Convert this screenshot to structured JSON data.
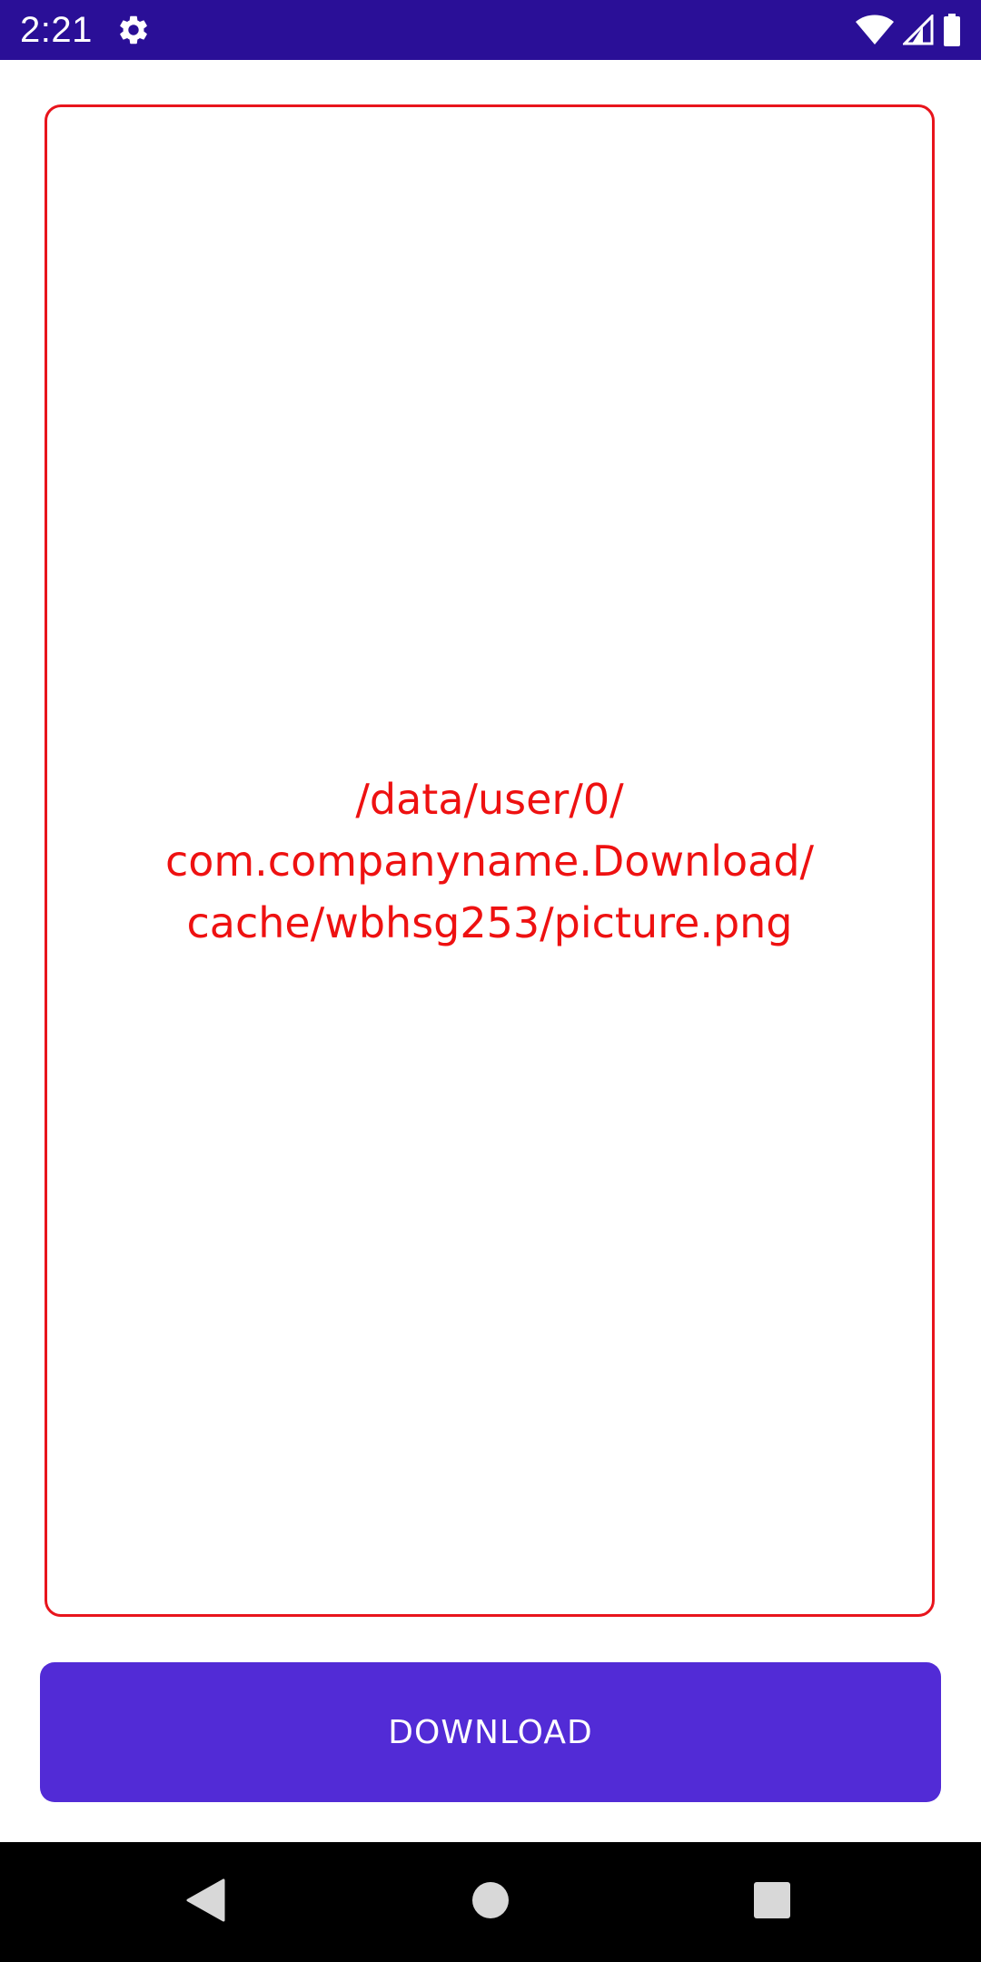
{
  "status_bar": {
    "time": "2:21",
    "background": "#2a0f97",
    "icons": [
      "settings-icon",
      "wifi-icon",
      "cellular-signal-icon",
      "battery-icon"
    ]
  },
  "main": {
    "path_lines": [
      "/data/user/0/",
      "com.companyname.Download/",
      "cache/wbhsg253/picture.png"
    ],
    "path_color": "#ee1111",
    "card_border_color": "#e8141c"
  },
  "download_button": {
    "label": "DOWNLOAD",
    "background": "#522bd6",
    "text_color": "#ffffff"
  },
  "nav_bar": {
    "icons": [
      "back-icon",
      "home-icon",
      "recents-icon"
    ],
    "background": "#000000"
  }
}
